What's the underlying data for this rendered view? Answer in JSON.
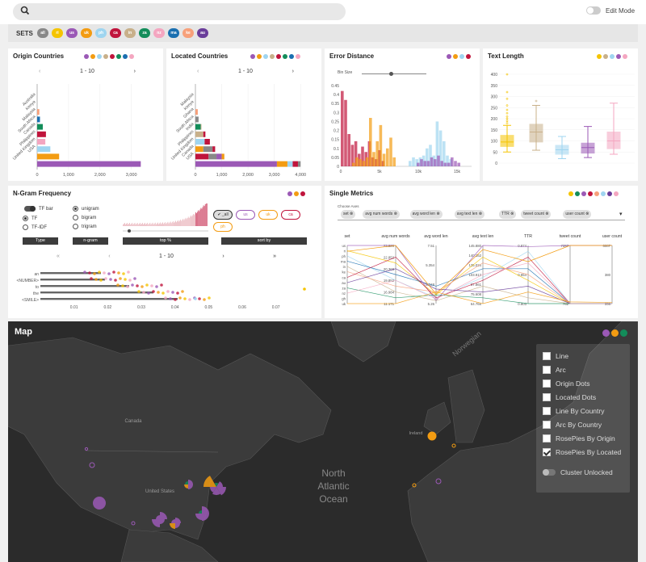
{
  "search": {
    "placeholder": ""
  },
  "edit_mode": {
    "label": "Edit Mode"
  },
  "sets": {
    "label": "SETS",
    "chips": [
      {
        "label": "all",
        "color": "#888888"
      },
      {
        "label": "ri",
        "color": "#f5c400"
      },
      {
        "label": "us",
        "color": "#9b59b6"
      },
      {
        "label": "uk",
        "color": "#f39c12"
      },
      {
        "label": "ph",
        "color": "#9fd5f0"
      },
      {
        "label": "ca",
        "color": "#c0143c"
      },
      {
        "label": "in",
        "color": "#c8b08a"
      },
      {
        "label": "za",
        "color": "#138d5a"
      },
      {
        "label": "nz",
        "color": "#f4a6c0"
      },
      {
        "label": "ma",
        "color": "#1a6fb0"
      },
      {
        "label": "ke",
        "color": "#f7a07a"
      },
      {
        "label": "au",
        "color": "#6a3d9a"
      }
    ]
  },
  "origin_panel": {
    "title": "Origin Countries",
    "pager": "1 - 10",
    "xticks": [
      "0",
      "1,000",
      "2,000",
      "3,000"
    ],
    "labels": [
      "Australia",
      "Kenya",
      "Malaysia",
      "South Africa",
      "Canada",
      "Philippines",
      "United Kingdom",
      "USA"
    ]
  },
  "located_panel": {
    "title": "Located Countries",
    "pager": "1 - 10",
    "xticks": [
      "0",
      "1,000",
      "2,000",
      "3,000",
      "4,000"
    ],
    "labels": [
      "Malaysia",
      "Kenya",
      "Ghana",
      "South Africa",
      "India",
      "Philippines",
      "United Kingdom",
      "Canada",
      "USA"
    ]
  },
  "error_panel": {
    "title": "Error Distance",
    "bin_label": "Bin Size",
    "yticks": [
      "0",
      "0.05",
      "0.1",
      "0.15",
      "0.2",
      "0.25",
      "0.3",
      "0.35",
      "0.4",
      "0.45"
    ],
    "xticks": [
      "0",
      "5k",
      "10k",
      "15k"
    ]
  },
  "text_panel": {
    "title": "Text Length",
    "yticks": [
      "0",
      "50",
      "100",
      "150",
      "200",
      "250",
      "300",
      "350",
      "400"
    ]
  },
  "ngram_panel": {
    "title": "N-Gram Frequency",
    "tf_bar": "TF bar",
    "radios_a": [
      "TF",
      "TF-IDF"
    ],
    "radios_b": [
      "unigram",
      "bigram",
      "trigram"
    ],
    "btn_type": "Type",
    "btn_ngram": "n-gram",
    "btn_top": "top %",
    "btn_sort": "sort by",
    "sort_chips": [
      "_all",
      "us",
      "uk",
      "ca",
      "ph"
    ],
    "pager": "1 - 10",
    "rows": [
      "an",
      "<NUMBER>",
      "to",
      "the",
      "<SMILE>"
    ],
    "xticks": [
      "0.01",
      "0.02",
      "0.03",
      "0.04",
      "0.05",
      "0.06",
      "0.07"
    ]
  },
  "metrics_panel": {
    "title": "Single Metrics",
    "choose_label": "Choose Axes",
    "axis_chips": [
      "set",
      "avg num words",
      "avg word len",
      "avg text len",
      "TTR",
      "tweet count",
      "user count"
    ],
    "axes": [
      "set",
      "avg num words",
      "avg word len",
      "avg text len",
      "TTR",
      "tweet count",
      "user count"
    ],
    "set_ticks": [
      "us",
      "ri",
      "ph",
      "ma",
      "in",
      "ke",
      "ca",
      "au",
      "za",
      "nz",
      "gh",
      "uk"
    ],
    "words_ticks": [
      "23.826",
      "22.852",
      "20.368",
      "19.852",
      "16.984",
      "11.171"
    ],
    "wordlen_ticks": [
      "7.51",
      "5.354",
      "5.348",
      "5.26"
    ],
    "textlen_ticks": [
      "145.880",
      "140.162",
      "135.024",
      "103.912",
      "87.861",
      "75.608",
      "64.766"
    ],
    "ttr_ticks": [
      "0.874",
      "0.854",
      "0.803"
    ],
    "tweet_ticks": [
      "7397",
      "762"
    ],
    "user_ticks": [
      "6087",
      "380",
      "356"
    ]
  },
  "map_panel": {
    "title": "Map",
    "labels": {
      "canada": "Canada",
      "us": "United States",
      "ireland": "Ireland",
      "atlantic1": "North",
      "atlantic2": "Atlantic",
      "atlantic3": "Ocean",
      "norwegian": "Norwegian"
    },
    "layers": [
      {
        "label": "Line",
        "checked": false
      },
      {
        "label": "Arc",
        "checked": false
      },
      {
        "label": "Origin Dots",
        "checked": false
      },
      {
        "label": "Located Dots",
        "checked": false
      },
      {
        "label": "Line By Country",
        "checked": false
      },
      {
        "label": "Arc By Country",
        "checked": false
      },
      {
        "label": "RosePies By Origin",
        "checked": false
      },
      {
        "label": "RosePies By Located",
        "checked": true
      }
    ],
    "cluster_label": "Cluster Unlocked"
  },
  "colors": {
    "us": "#9b59b6",
    "uk": "#f39c12",
    "ca": "#c0143c",
    "ph": "#9fd5f0",
    "ri": "#f5c400",
    "in": "#c8b08a",
    "za": "#138d5a",
    "nz": "#f4a6c0",
    "ma": "#1a6fb0",
    "ke": "#f7a07a",
    "au": "#6a3d9a",
    "gray": "#888888"
  }
}
